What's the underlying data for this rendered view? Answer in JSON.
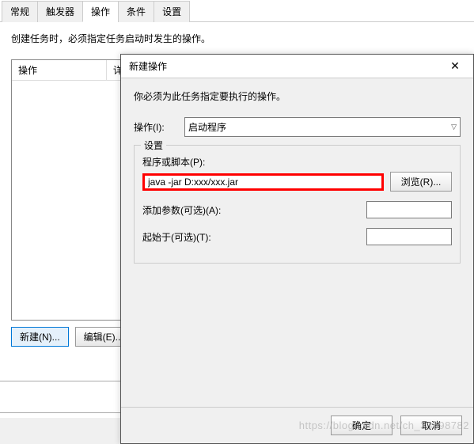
{
  "tabs": {
    "general": "常规",
    "triggers": "触发器",
    "actions": "操作",
    "conditions": "条件",
    "settings": "设置"
  },
  "main": {
    "description": "创建任务时，必须指定任务启动时发生的操作。",
    "list_header_action": "操作",
    "list_header_details": "详",
    "btn_new": "新建(N)...",
    "btn_edit": "编辑(E)..."
  },
  "dialog": {
    "title": "新建操作",
    "description": "你必须为此任务指定要执行的操作。",
    "action_label": "操作(I):",
    "action_value": "启动程序",
    "group_title": "设置",
    "program_label": "程序或脚本(P):",
    "program_value": "java -jar D:xxx/xxx.jar",
    "browse": "浏览(R)...",
    "args_label": "添加参数(可选)(A):",
    "startin_label": "起始于(可选)(T):",
    "ok": "确定",
    "cancel": "取消"
  },
  "watermark": "https://blog.csdn.net/ch_33598782"
}
